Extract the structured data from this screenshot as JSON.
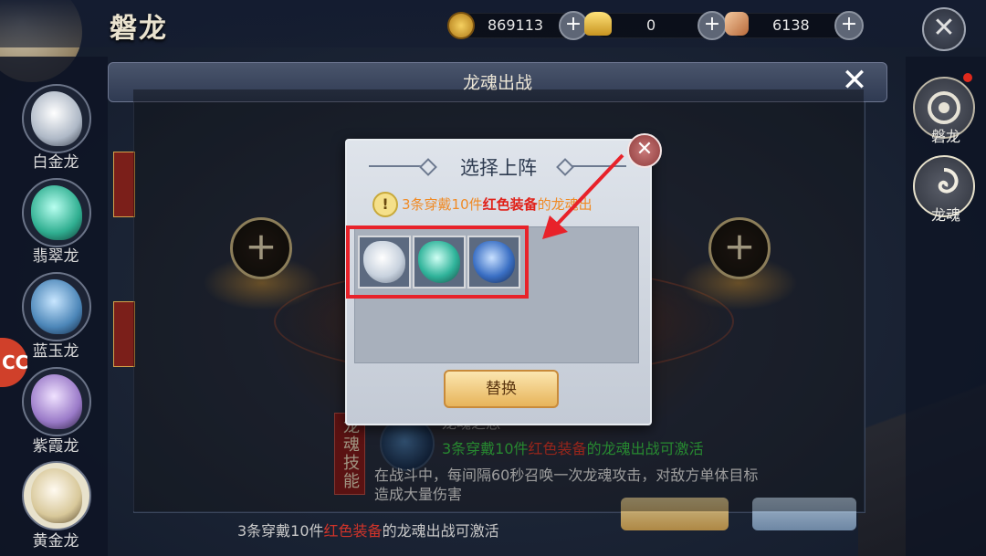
{
  "header": {
    "title": "磐龙",
    "resources": [
      {
        "icon": "copper-coin-icon",
        "value": "869113"
      },
      {
        "icon": "gold-ingot-icon",
        "value": "0"
      },
      {
        "icon": "gem-icon",
        "value": "6138"
      }
    ],
    "plus_label": "+",
    "close_label": "✕"
  },
  "sidebar": {
    "items": [
      {
        "label": "白金龙",
        "color": "#dfe6ee"
      },
      {
        "label": "翡翠龙",
        "color": "#3fb79a"
      },
      {
        "label": "蓝玉龙",
        "color": "#4c86b8"
      },
      {
        "label": "紫霞龙",
        "color": "#9a7ac8"
      },
      {
        "label": "黄金龙",
        "color": "#e8dcb8"
      }
    ],
    "badge": "CC"
  },
  "right_nav": {
    "items": [
      {
        "label": "磐龙",
        "icon": "dragon-emblem-icon"
      },
      {
        "label": "龙魂",
        "icon": "dragon-soul-icon"
      }
    ]
  },
  "panel": {
    "title": "龙魂出战",
    "close_label": "✕",
    "slot_plus": "+",
    "skill_tag": "龙魂技能",
    "skill_name": "龙魂之怒",
    "skill_cond_pre": "3条穿戴10件",
    "skill_cond_red": "红色装备",
    "skill_cond_post": "的龙魂出战可激活",
    "skill_desc": "在战斗中，每间隔60秒召唤一次龙魂攻击，对敌方单体目标造成大量伤害",
    "bottom_pre": "3条穿戴10件",
    "bottom_red": "红色装备",
    "bottom_post": "的龙魂出战可激活"
  },
  "dialog": {
    "title": "选择上阵",
    "close_label": "✕",
    "warn_symbol": "!",
    "warn_pre": "3条穿戴10件",
    "warn_red": "红色装备",
    "warn_post": "的龙魂出",
    "slots": [
      {
        "name": "白金龙",
        "color": "#e4ebf2"
      },
      {
        "name": "翡翠龙",
        "color": "#2fb39a"
      },
      {
        "name": "蓝玉龙",
        "color": "#3a6fc4"
      }
    ],
    "replace_label": "替换"
  },
  "colors": {
    "highlight": "#e8222a",
    "warn_text": "#f08a24",
    "red_text": "#e0221a",
    "green_text": "#3cd24a"
  }
}
